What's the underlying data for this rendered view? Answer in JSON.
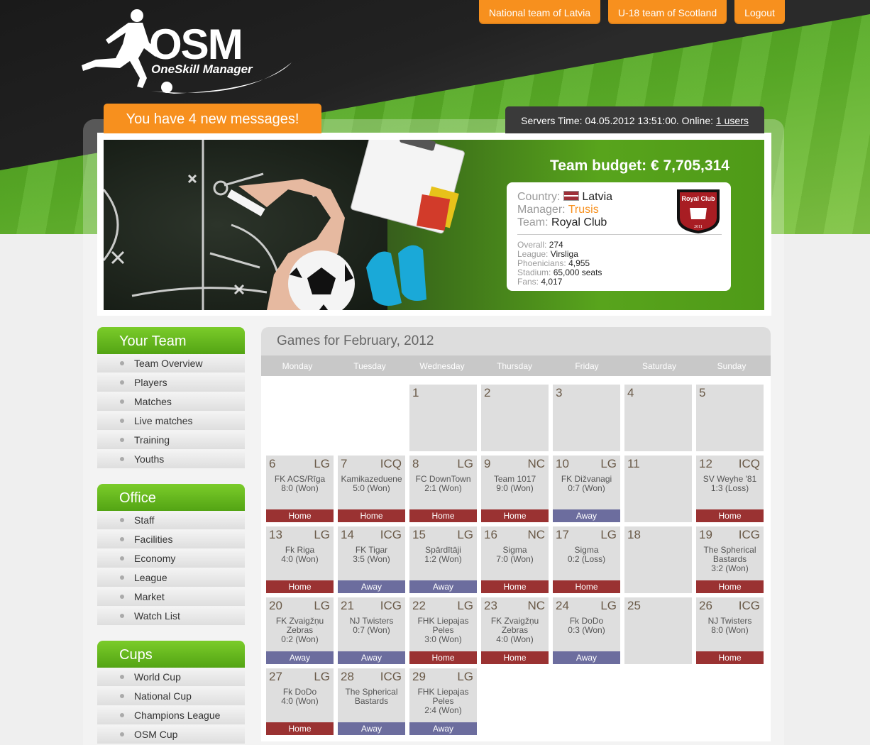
{
  "header": {
    "logo_main": "OSM",
    "logo_sub": "OneSkill Manager",
    "buttons": [
      {
        "label": "National team of Latvia"
      },
      {
        "label": "U-18 team of Scotland"
      },
      {
        "label": "Logout"
      }
    ],
    "messages_label": "You have 4 new messages!",
    "server_time_text": "Servers Time: 04.05.2012 13:51:00. Online: ",
    "online_users_link": "1 users"
  },
  "team_card": {
    "budget": "Team budget: € 7,705,314",
    "country_label": "Country:",
    "country_value": "Latvia",
    "manager_label": "Manager:",
    "manager_value": "Trusis",
    "team_label": "Team:",
    "team_value": "Royal Club",
    "crest_text": "Royal Club",
    "crest_year": "2011",
    "stats": [
      {
        "label": "Overall:",
        "value": "274"
      },
      {
        "label": "League:",
        "value": "Virsliga"
      },
      {
        "label": "Phoenicians:",
        "value": "4,955"
      },
      {
        "label": "Stadium:",
        "value": "65,000 seats"
      },
      {
        "label": "Fans:",
        "value": "4,017"
      }
    ],
    "manager_color": "#f7901e"
  },
  "sidebar": {
    "sections": [
      {
        "title": "Your Team",
        "items": [
          "Team Overview",
          "Players",
          "Matches",
          "Live matches",
          "Training",
          "Youths"
        ]
      },
      {
        "title": "Office",
        "items": [
          "Staff",
          "Facilities",
          "Economy",
          "League",
          "Market",
          "Watch List"
        ]
      },
      {
        "title": "Cups",
        "items": [
          "World Cup",
          "National Cup",
          "Champions League",
          "OSM Cup"
        ]
      }
    ]
  },
  "calendar": {
    "title": "Games for February, 2012",
    "weekdays": [
      "Monday",
      "Tuesday",
      "Wednesday",
      "Thursday",
      "Friday",
      "Saturday",
      "Sunday"
    ],
    "home_color": "#9a3232",
    "away_color": "#6c6d9e",
    "days": [
      {
        "day": "1"
      },
      {
        "day": "2"
      },
      {
        "day": "3"
      },
      {
        "day": "4"
      },
      {
        "day": "5"
      },
      {
        "day": "6",
        "comp": "LG",
        "opp": "FK ACS/Rīga",
        "score": "8:0 (Won)",
        "venue": "Home"
      },
      {
        "day": "7",
        "comp": "ICQ",
        "opp": "Kamikazeduene",
        "score": "5:0 (Won)",
        "venue": "Home"
      },
      {
        "day": "8",
        "comp": "LG",
        "opp": "FC DownTown",
        "score": "2:1 (Won)",
        "venue": "Home"
      },
      {
        "day": "9",
        "comp": "NC",
        "opp": "Team 1017",
        "score": "9:0 (Won)",
        "venue": "Home"
      },
      {
        "day": "10",
        "comp": "LG",
        "opp": "FK Dižvanagi",
        "score": "0:7 (Won)",
        "venue": "Away"
      },
      {
        "day": "11"
      },
      {
        "day": "12",
        "comp": "ICQ",
        "opp": "SV Weyhe '81",
        "score": "1:3 (Loss)",
        "venue": "Home"
      },
      {
        "day": "13",
        "comp": "LG",
        "opp": "Fk Riga",
        "score": "4:0 (Won)",
        "venue": "Home"
      },
      {
        "day": "14",
        "comp": "ICG",
        "opp": "FK Tigar",
        "score": "3:5 (Won)",
        "venue": "Away"
      },
      {
        "day": "15",
        "comp": "LG",
        "opp": "Spārdītāji",
        "score": "1:2 (Won)",
        "venue": "Away"
      },
      {
        "day": "16",
        "comp": "NC",
        "opp": "Sigma",
        "score": "7:0 (Won)",
        "venue": "Home"
      },
      {
        "day": "17",
        "comp": "LG",
        "opp": "Sigma",
        "score": "0:2 (Loss)",
        "venue": "Home"
      },
      {
        "day": "18"
      },
      {
        "day": "19",
        "comp": "ICG",
        "opp": "The Spherical Bastards",
        "score": "3:2 (Won)",
        "venue": "Home"
      },
      {
        "day": "20",
        "comp": "LG",
        "opp": "FK Zvaigžņu Zebras",
        "score": "0:2 (Won)",
        "venue": "Away"
      },
      {
        "day": "21",
        "comp": "ICG",
        "opp": "NJ Twisters",
        "score": "0:7 (Won)",
        "venue": "Away"
      },
      {
        "day": "22",
        "comp": "LG",
        "opp": "FHK Liepajas Peles",
        "score": "3:0 (Won)",
        "venue": "Home"
      },
      {
        "day": "23",
        "comp": "NC",
        "opp": "FK Zvaigžņu Zebras",
        "score": "4:0 (Won)",
        "venue": "Home"
      },
      {
        "day": "24",
        "comp": "LG",
        "opp": "Fk DoDo",
        "score": "0:3 (Won)",
        "venue": "Away"
      },
      {
        "day": "25"
      },
      {
        "day": "26",
        "comp": "ICG",
        "opp": "NJ Twisters",
        "score": "8:0 (Won)",
        "venue": "Home"
      },
      {
        "day": "27",
        "comp": "LG",
        "opp": "Fk DoDo",
        "score": "4:0 (Won)",
        "venue": "Home"
      },
      {
        "day": "28",
        "comp": "ICG",
        "opp": "The Spherical Bastards",
        "score": "",
        "venue": "Away"
      },
      {
        "day": "29",
        "comp": "LG",
        "opp": "FHK Liepajas Peles",
        "score": "2:4 (Won)",
        "venue": "Away"
      }
    ]
  }
}
